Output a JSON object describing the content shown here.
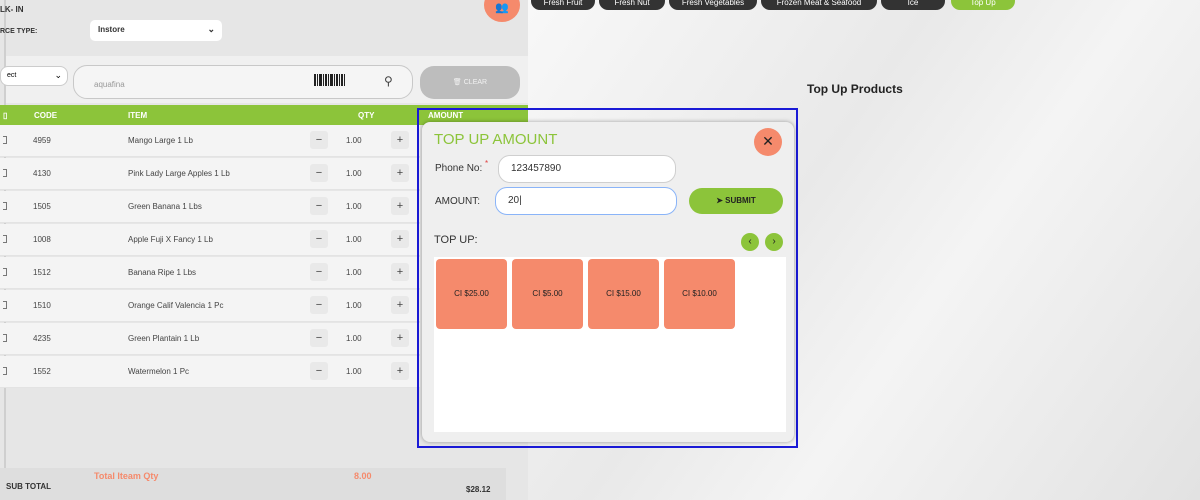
{
  "pos": {
    "title": "LK- IN",
    "source_label": "RCE TYPE:",
    "source_value": "Instore",
    "select2_value": "ect",
    "search_placeholder": "aquafina",
    "clear_label": "CLEAR"
  },
  "table": {
    "headers": {
      "code": "CODE",
      "item": "ITEM",
      "qty": "QTY",
      "amount": "AMOUNT"
    },
    "rows": [
      {
        "code": "4959",
        "item": "Mango Large 1 Lb",
        "qty": "1.00"
      },
      {
        "code": "4130",
        "item": "Pink Lady Large Apples 1 Lb",
        "qty": "1.00"
      },
      {
        "code": "1505",
        "item": "Green Banana 1 Lbs",
        "qty": "1.00"
      },
      {
        "code": "1008",
        "item": "Apple Fuji X Fancy 1 Lb",
        "qty": "1.00"
      },
      {
        "code": "1512",
        "item": "Banana Ripe 1 Lbs",
        "qty": "1.00"
      },
      {
        "code": "1510",
        "item": "Orange Calif Valencia 1 Pc",
        "qty": "1.00"
      },
      {
        "code": "4235",
        "item": "Green Plantain 1 Lb",
        "qty": "1.00"
      },
      {
        "code": "1552",
        "item": "Watermelon 1 Pc",
        "qty": "1.00"
      }
    ],
    "minus": "−",
    "plus": "+"
  },
  "summary": {
    "subtotal_label": "SUB TOTAL",
    "total_qty_label": "Total Iteam Qty",
    "total_qty_value": "8.00",
    "subtotal_value": "$28.12"
  },
  "categories": [
    "Fresh Fruit",
    "Fresh Nut",
    "Fresh Vegetables",
    "Frozen Meat & Seafood",
    "Ice",
    "Top Up"
  ],
  "topup_products_heading": "Top Up Products",
  "modal": {
    "title": "TOP UP AMOUNT",
    "close_icon": "close-icon",
    "phone_label": "Phone No:",
    "required_mark": "*",
    "phone_value": "123457890",
    "amount_label": "AMOUNT:",
    "amount_value": "20",
    "submit_label": "SUBMIT",
    "topup_label": "TOP UP:",
    "prev": "‹",
    "next": "›",
    "tiles": [
      "CI $25.00",
      "CI $5.00",
      "CI $15.00",
      "CI $10.00"
    ]
  },
  "colors": {
    "accent_green": "#8cc43a",
    "accent_orange": "#f58a6c",
    "highlight": "#1a1ad6"
  }
}
